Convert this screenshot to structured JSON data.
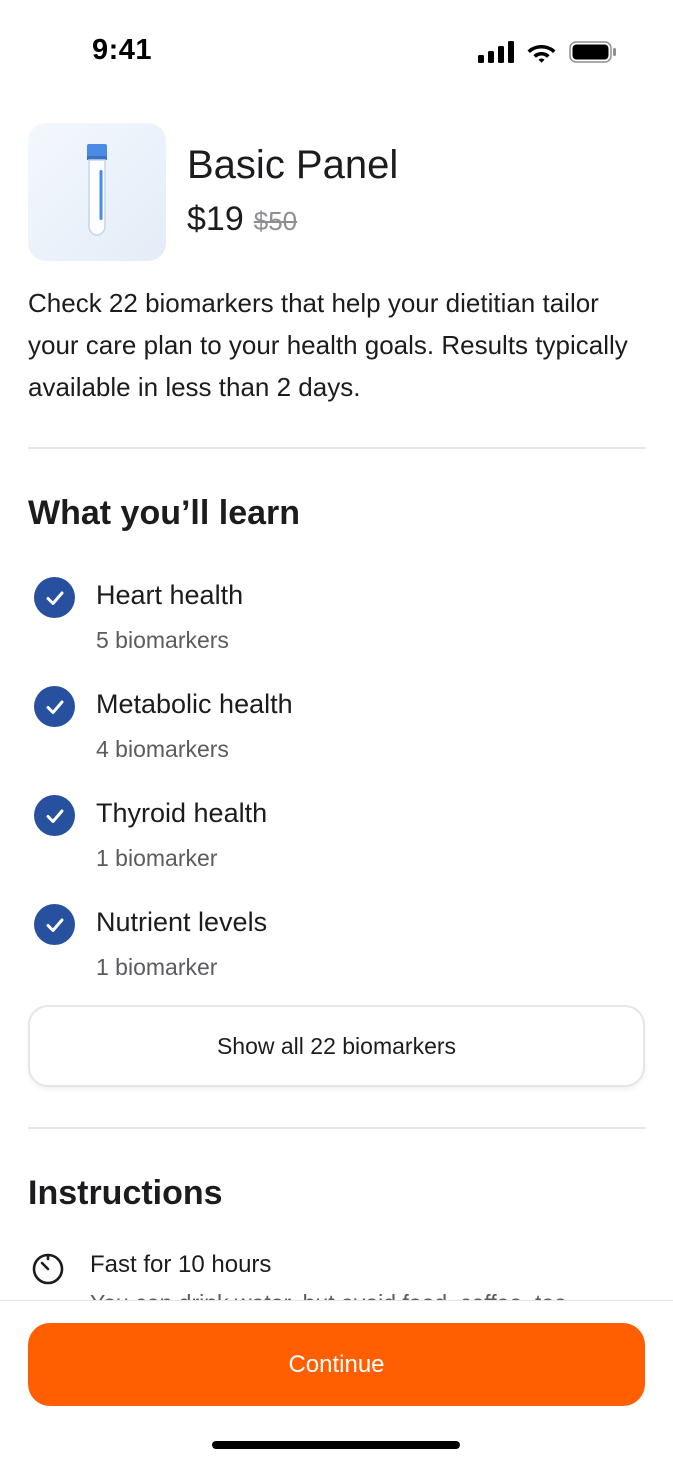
{
  "status_bar": {
    "time": "9:41",
    "icons": [
      "cellular-signal-icon",
      "wifi-icon",
      "battery-icon"
    ]
  },
  "product": {
    "image_icon": "test-tube-icon",
    "title": "Basic Panel",
    "price": "$19",
    "original_price": "$50",
    "description": "Check 22 biomarkers that help your dietitian tailor your care plan to your health goals. Results typically available in less than 2 days."
  },
  "learn": {
    "title": "What you’ll learn",
    "items": [
      {
        "name": "Heart health",
        "count": "5 biomarkers",
        "icon": "check-circle-icon"
      },
      {
        "name": "Metabolic health",
        "count": "4 biomarkers",
        "icon": "check-circle-icon"
      },
      {
        "name": "Thyroid health",
        "count": "1 biomarker",
        "icon": "check-circle-icon"
      },
      {
        "name": "Nutrient levels",
        "count": "1 biomarker",
        "icon": "check-circle-icon"
      }
    ],
    "show_all_label": "Show all 22 biomarkers"
  },
  "instructions": {
    "title": "Instructions",
    "items": [
      {
        "icon": "timer-icon",
        "title": "Fast for 10 hours",
        "subtitle": "You can drink water, but avoid food, coffee, tea"
      }
    ]
  },
  "footer": {
    "continue_label": "Continue"
  },
  "colors": {
    "accent": "#ff5f00",
    "check": "#27509e",
    "text_primary": "#1c1c1e",
    "text_secondary": "#5b5b60",
    "divider": "#e6e6e8"
  }
}
